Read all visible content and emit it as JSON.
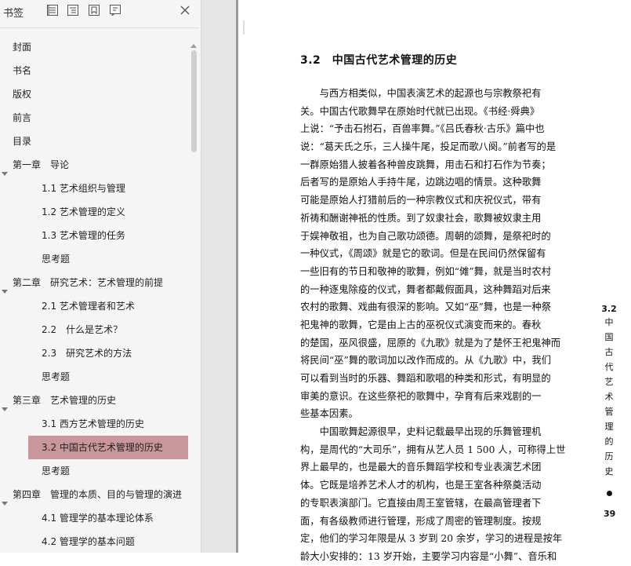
{
  "bookmarks": {
    "title": "书签",
    "items": [
      {
        "label": "封面",
        "level": 0,
        "expandable": false
      },
      {
        "label": "书名",
        "level": 0,
        "expandable": false
      },
      {
        "label": "版权",
        "level": 0,
        "expandable": false
      },
      {
        "label": "前言",
        "level": 0,
        "expandable": false
      },
      {
        "label": "目录",
        "level": 0,
        "expandable": false
      },
      {
        "label": "第一章　导论",
        "level": 0,
        "expandable": true
      },
      {
        "label": "1.1  艺术组织与管理",
        "level": 1,
        "expandable": false
      },
      {
        "label": "1.2  艺术管理的定义",
        "level": 1,
        "expandable": false
      },
      {
        "label": "1.3  艺术管理的任务",
        "level": 1,
        "expandable": false
      },
      {
        "label": "思考题",
        "level": 1,
        "expandable": false
      },
      {
        "label": "第二章　研究艺术：艺术管理的前提",
        "level": 0,
        "expandable": true
      },
      {
        "label": "2.1  艺术管理者和艺术",
        "level": 1,
        "expandable": false
      },
      {
        "label": "2.2　什么是艺术？",
        "level": 1,
        "expandable": false
      },
      {
        "label": "2.3　研究艺术的方法",
        "level": 1,
        "expandable": false
      },
      {
        "label": "思考题",
        "level": 1,
        "expandable": false
      },
      {
        "label": "第三章　艺术管理的历史",
        "level": 0,
        "expandable": true
      },
      {
        "label": "3.1  西方艺术管理的历史",
        "level": 1,
        "expandable": false
      },
      {
        "label": "3.2  中国古代艺术管理的历史",
        "level": 1,
        "expandable": false,
        "selected": true
      },
      {
        "label": "思考题",
        "level": 1,
        "expandable": false
      },
      {
        "label": "第四章　管理的本质、目的与管理的演进",
        "level": 0,
        "expandable": true
      },
      {
        "label": "4.1  管理学的基本理论体系",
        "level": 1,
        "expandable": false
      },
      {
        "label": "4.2  管理学的基本问题",
        "level": 1,
        "expandable": false
      }
    ]
  },
  "colors": {
    "selected_bg": "#c9969b",
    "panel_bg": "#f5f5f5",
    "gap_bg": "#e6e6e6"
  },
  "toolbar_icons": [
    "expand-all-icon",
    "collapse-all-icon",
    "add-bookmark-icon",
    "bookmark-options-icon",
    "close-icon"
  ],
  "page": {
    "heading": "3.2　中国古代艺术管理的历史",
    "lines": [
      "　　与西方相类似，中国表演艺术的起源也与宗教祭祀有",
      "关。中国古代歌舞早在原始时代就已出现。《书经·舜典》",
      "上说：“予击石拊石，百兽率舞。”《吕氏春秋·古乐》篇中也",
      "说：“葛天氏之乐，三人操牛尾，投足而歌八阕。”前者写的是",
      "一群原始猎人披着各种兽皮跳舞，用击石和打石作为节奏；",
      "后者写的是原始人手持牛尾，边跳边唱的情景。这种歌舞",
      "可能是原始人打猎前后的一种宗教仪式和庆祝仪式，带有",
      "祈祷和酬谢神祇的性质。到了奴隶社会，歌舞被奴隶主用",
      "于娱神敬祖，也为自己歌功颂德。周朝的颂舞，是祭祀时的",
      "一种仪式，《周颂》就是它的歌词。但是在民间仍然保留有",
      "一些旧有的节日和敬神的歌舞，例如“傩”舞，就是当时农村",
      "的一种逐鬼除疫的仪式，舞者都戴假面具，这种舞蹈对后来",
      "农村的歌舞、戏曲有很深的影响。又如“巫”舞，也是一种祭",
      "祀鬼神的歌舞，它是由上古的巫祝仪式演变而来的。春秋",
      "的楚国，巫风很盛，屈原的《九歌》就是为了楚怀王祀鬼神而",
      "将民间“巫”舞的歌词加以改作而成的。从《九歌》中，我们",
      "可以看到当时的乐器、舞蹈和歌唱的种类和形式，有明显的",
      "审美的意识。在这些祭祀的歌舞中，孕育有后来戏剧的一",
      "些基本因素。",
      "　　中国歌舞起源很早，史料记载最早出现的乐舞管理机",
      "构，是周代的“大司乐”，拥有从艺人员 1 500 人，可称得上世",
      "界上最早的，也是最大的音乐舞蹈学校和专业表演艺术团",
      "体。它既是培养艺术人才的机构，也是王室各种祭奠活动",
      "的专职表演部门。它直接由周王室管辖，在最高管理者下",
      "面，有各级教师进行管理，形成了周密的管理制度。按规",
      "定，他们的学习年限是从 3 岁到 20 余岁，学习的进程是按年",
      "龄大小安排的：13 岁开始，主要学习内容是“小舞”、音乐和"
    ],
    "side_tab": {
      "number": "3.2",
      "chars": [
        "中",
        "国",
        "古",
        "代",
        "艺",
        "术",
        "管",
        "理",
        "的",
        "历",
        "史"
      ]
    },
    "page_number": "39"
  }
}
